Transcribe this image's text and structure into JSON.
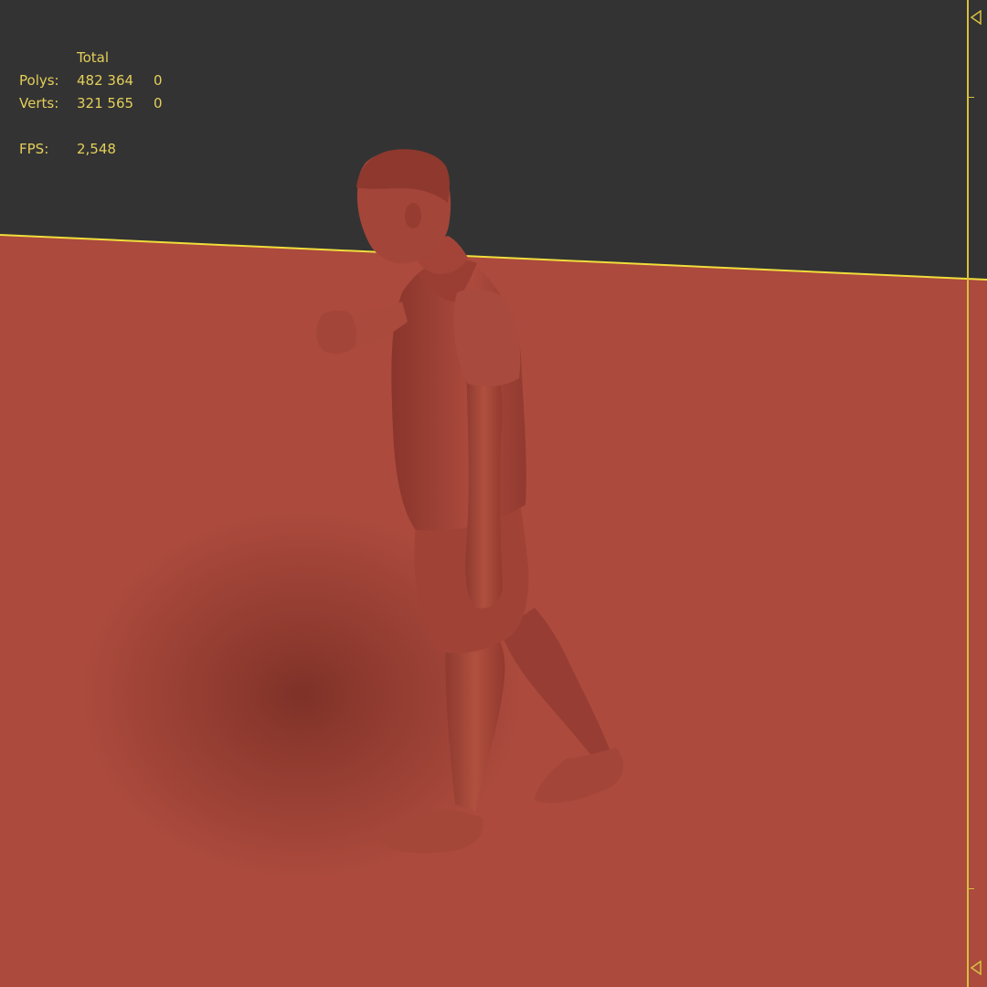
{
  "stats": {
    "header": "Total",
    "polys_label": "Polys:",
    "polys_total": "482 364",
    "polys_selected": "0",
    "verts_label": "Verts:",
    "verts_total": "321 565",
    "verts_selected": "0",
    "fps_label": "FPS:",
    "fps_value": "2,548"
  },
  "colors": {
    "background": "#333333",
    "ground_plane": "#ab4a3d",
    "model": "#a7483d",
    "stats_text": "#e4cf5a",
    "horizon_line": "#f0de3c",
    "slider": "#d9bf3f"
  },
  "icons": {
    "slider_start": "triangle-left-icon",
    "slider_end": "triangle-left-icon"
  }
}
